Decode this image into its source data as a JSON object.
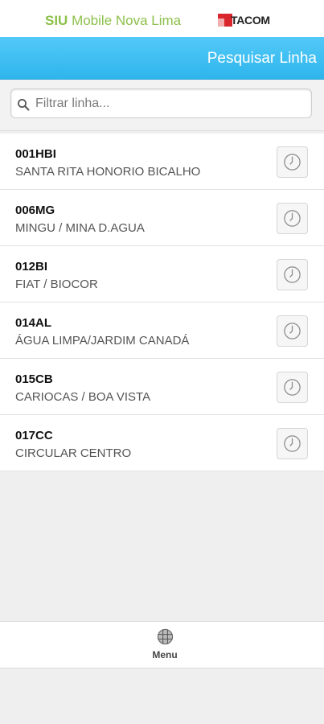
{
  "brand": {
    "siu": "SIU",
    "rest": " Mobile Nova Lima",
    "tacom": "TACOM"
  },
  "header": {
    "title": "Pesquisar Linha"
  },
  "search": {
    "placeholder": "Filtrar linha...",
    "value": ""
  },
  "lines": [
    {
      "code": "001HBI",
      "name": "SANTA RITA HONORIO BICALHO"
    },
    {
      "code": "006MG",
      "name": "MINGU / MINA D.AGUA"
    },
    {
      "code": "012BI",
      "name": "FIAT / BIOCOR"
    },
    {
      "code": "014AL",
      "name": "ÁGUA LIMPA/JARDIM CANADÁ"
    },
    {
      "code": "015CB",
      "name": "CARIOCAS / BOA VISTA"
    },
    {
      "code": "017CC",
      "name": "CIRCULAR CENTRO"
    }
  ],
  "nav": {
    "menu_label": "Menu",
    "menu_icon": "grid-globe-icon"
  },
  "colors": {
    "header": "#2fb5ec",
    "brand_green": "#8cc04a",
    "tacom_red": "#d9262c"
  }
}
